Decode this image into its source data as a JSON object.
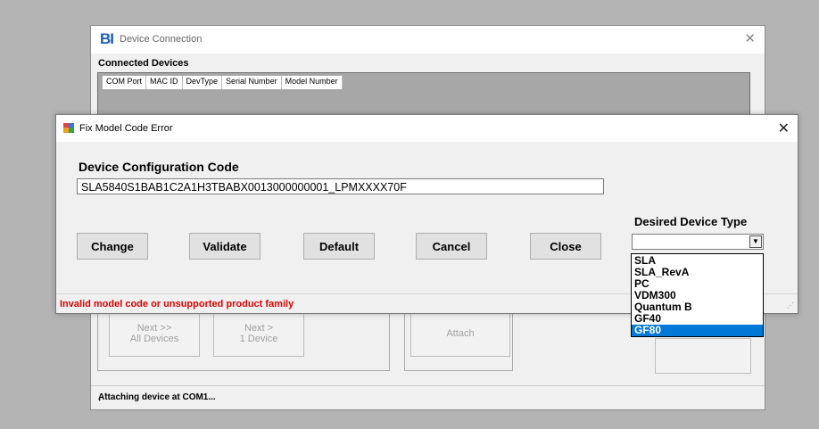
{
  "bg_window": {
    "logo": "BI",
    "title": "Device Connection",
    "close_glyph": "✕",
    "section_label": "Connected Devices",
    "columns": [
      "COM Port",
      "MAC ID",
      "DevType",
      "Serial Number",
      "Model Number"
    ],
    "buttons": {
      "next_all": "Next >>\nAll Devices",
      "next_one": "Next >\n1 Device",
      "attach": "Attach"
    },
    "status": "Attaching device at COM1..."
  },
  "dialog": {
    "title": "Fix Model Code Error",
    "close_glyph": "✕",
    "config_label": "Device Configuration Code",
    "config_value": "SLA5840S1BAB1C2A1H3TBABX0013000000001_LPMXXXX70F",
    "buttons": {
      "change": "Change",
      "validate": "Validate",
      "default": "Default",
      "cancel": "Cancel",
      "close": "Close"
    },
    "desired_type_label": "Desired Device Type",
    "select_value": "",
    "dropdown_arrow": "▼",
    "options": [
      "SLA",
      "SLA_RevA",
      "PC",
      "VDM300",
      "Quantum B",
      "GF40",
      "GF80"
    ],
    "highlighted_option": "GF80",
    "error": "Invalid model code or unsupported product family"
  },
  "colors": {
    "error": "#e00000",
    "selection": "#0078d7",
    "brand": "#1d5fb4"
  }
}
